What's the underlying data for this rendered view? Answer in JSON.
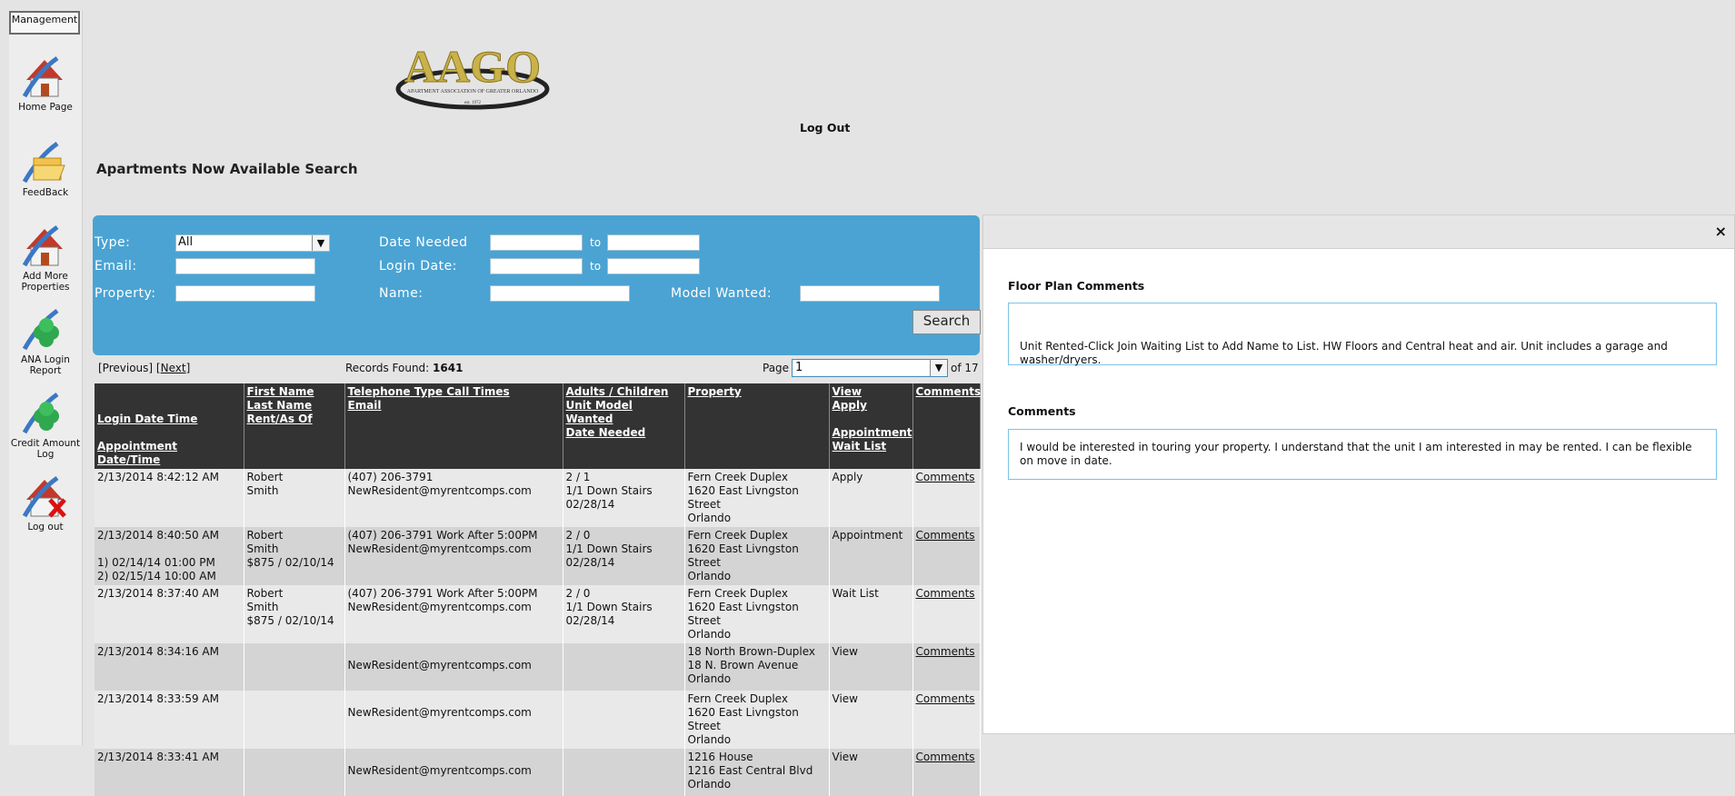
{
  "sidebar": {
    "header": "Management",
    "items": [
      {
        "label": "Home Page",
        "icon": "home-icon"
      },
      {
        "label": "FeedBack",
        "icon": "folder-home-icon"
      },
      {
        "label": "Add More Properties",
        "icon": "add-home-icon"
      },
      {
        "label": "ANA Login Report",
        "icon": "clover-report-icon"
      },
      {
        "label": "Credit Amount Log",
        "icon": "clover-log-icon"
      },
      {
        "label": "Log out",
        "icon": "logout-home-icon"
      }
    ]
  },
  "header": {
    "logo_text": "AAGO",
    "logo_subtext": "APARTMENT ASSOCIATION OF GREATER ORLANDO",
    "logo_est": "est. 1972",
    "logout": "Log Out",
    "page_title": "Apartments Now Available Search"
  },
  "search": {
    "type_label": "Type:",
    "type_value": "All",
    "email_label": "Email:",
    "property_label": "Property:",
    "date_needed_label": "Date Needed",
    "login_date_label": "Login Date:",
    "name_label": "Name:",
    "to1": "to",
    "to2": "to",
    "model_wanted_label": "Model Wanted:",
    "button": "Search"
  },
  "pager": {
    "previous": "[Previous]",
    "next_open": "[",
    "next": "Next",
    "next_close": "]",
    "records_label": "Records Found:",
    "records_value": "1641",
    "page_label": "Page",
    "page_value": "1",
    "page_total": "of 17"
  },
  "table": {
    "headers": [
      [
        "",
        "",
        "Login Date Time",
        "",
        "Appointment Date/Time"
      ],
      [
        "First Name",
        "Last Name",
        "Rent/As Of"
      ],
      [
        "Telephone  Type  Call Times",
        "Email"
      ],
      [
        "Adults / Children",
        "Unit Model Wanted",
        "Date Needed"
      ],
      [
        "Property"
      ],
      [
        "View",
        "Apply",
        "",
        "Appointment",
        "Wait List"
      ],
      [
        "Comments"
      ]
    ],
    "rows": [
      {
        "login": "2/13/2014 8:42:12 AM",
        "appt": "",
        "first": "Robert",
        "last": "Smith",
        "rent": "",
        "phone": "(407) 206-3791",
        "email": "NewResident@myrentcomps.com",
        "adults": "2 / 1",
        "model": "1/1 Down Stairs",
        "date": "02/28/14",
        "prop1": "Fern Creek Duplex",
        "prop2": "1620 East Livngston Street",
        "prop3": "Orlando",
        "action": "Apply",
        "comments": "Comments"
      },
      {
        "login": "2/13/2014 8:40:50 AM",
        "appt": "1) 02/14/14 01:00 PM\n2) 02/15/14 10:00 AM",
        "first": "Robert",
        "last": "Smith",
        "rent": "$875 / 02/10/14",
        "phone": "(407) 206-3791  Work  After 5:00PM",
        "email": "NewResident@myrentcomps.com",
        "adults": "2 / 0",
        "model": "1/1 Down Stairs",
        "date": "02/28/14",
        "prop1": "Fern Creek Duplex",
        "prop2": "1620 East Livngston Street",
        "prop3": "Orlando",
        "action": "Appointment",
        "comments": "Comments"
      },
      {
        "login": "2/13/2014 8:37:40 AM",
        "appt": "",
        "first": "Robert",
        "last": "Smith",
        "rent": "$875 / 02/10/14",
        "phone": "(407) 206-3791  Work  After 5:00PM",
        "email": "NewResident@myrentcomps.com",
        "adults": "2 / 0",
        "model": "1/1 Down Stairs",
        "date": "02/28/14",
        "prop1": "Fern Creek Duplex",
        "prop2": "1620 East Livngston Street",
        "prop3": "Orlando",
        "action": "Wait List",
        "comments": "Comments"
      },
      {
        "login": "2/13/2014 8:34:16 AM",
        "appt": "",
        "first": "",
        "last": "",
        "rent": "",
        "phone": "",
        "email": "NewResident@myrentcomps.com",
        "adults": "",
        "model": "",
        "date": "",
        "prop1": "18 North Brown-Duplex",
        "prop2": "18 N. Brown Avenue",
        "prop3": "Orlando",
        "action": "View",
        "comments": "Comments"
      },
      {
        "login": "2/13/2014 8:33:59 AM",
        "appt": "",
        "first": "",
        "last": "",
        "rent": "",
        "phone": "",
        "email": "NewResident@myrentcomps.com",
        "adults": "",
        "model": "",
        "date": "",
        "prop1": "Fern Creek Duplex",
        "prop2": "1620 East Livngston Street",
        "prop3": "Orlando",
        "action": "View",
        "comments": "Comments"
      },
      {
        "login": "2/13/2014 8:33:41 AM",
        "appt": "",
        "first": "",
        "last": "",
        "rent": "",
        "phone": "",
        "email": "NewResident@myrentcomps.com",
        "adults": "",
        "model": "",
        "date": "",
        "prop1": "1216 House",
        "prop2": "1216 East Central Blvd",
        "prop3": "Orlando",
        "action": "View",
        "comments": "Comments"
      }
    ]
  },
  "modal": {
    "close": "×",
    "floor_plan_heading": "Floor Plan Comments",
    "floor_plan_text": "Unit Rented-Click Join Waiting List to Add Name to List. HW Floors and Central heat and air. Unit includes a garage and washer/dryers.",
    "comments_heading": "Comments",
    "comments_text": "I would be interested in touring your property. I understand that the unit I am interested in may be rented. I can be flexible on move in date."
  },
  "colors": {
    "panel": "#4aa3d3",
    "header_row": "#333333",
    "modal_border": "#7cc3e6"
  }
}
